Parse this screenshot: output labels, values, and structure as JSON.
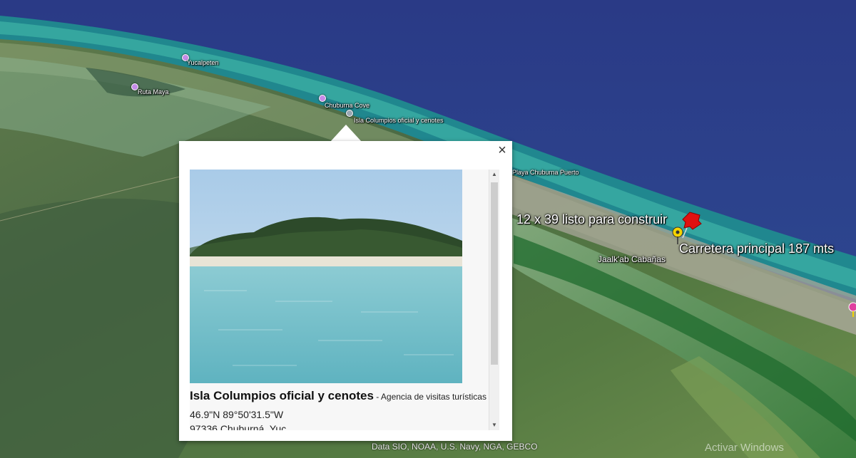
{
  "map": {
    "labels": {
      "yucalpeten": "Yucalpeten",
      "ruta": "Ruta Maya",
      "chuburna_cove": "Chuburna Cove",
      "isla_columpios": "Isla Columpios oficial y cenotes",
      "playa_chuburna": "Playa Chuburna Puerto",
      "lot_size": "12 x 39 listo para construir",
      "carretera": "Carretera principal 187 mts",
      "jaalkab": "Jaalk'ab Cabañas"
    },
    "attribution": "Data SIO, NOAA, U.S. Navy, NGA, GEBCO",
    "watermark": "Activar Windows"
  },
  "popup": {
    "close_label": "×",
    "title": "Isla Columpios oficial y cenotes",
    "category": " - Agencia de visitas turísticas",
    "coords": "46.9\"N 89°50'31.5\"W",
    "address": "97336 Chuburná, Yuc.",
    "scroll_up": "▲",
    "scroll_down": "▼"
  },
  "colors": {
    "ocean": "#2d3f8a",
    "pin_red": "#e01010",
    "pin_yellow": "#f5d400",
    "poi": "#c58be8"
  }
}
